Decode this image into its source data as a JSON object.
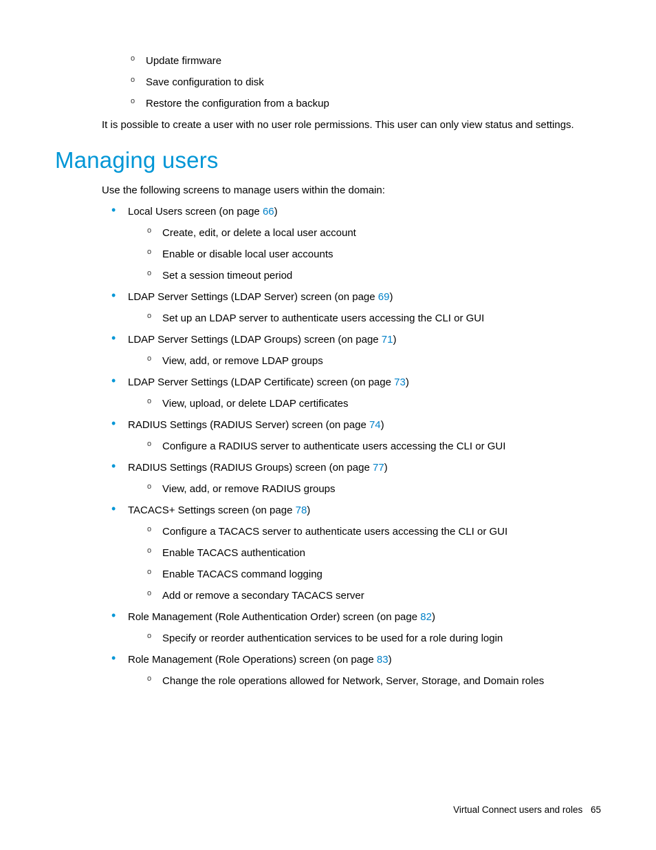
{
  "top_sub_items": [
    "Update firmware",
    "Save configuration to disk",
    "Restore the configuration from a backup"
  ],
  "body_para": "It is possible to create a user with no user role permissions. This user can only view status and settings.",
  "heading": "Managing users",
  "intro": "Use the following screens to manage users within the domain:",
  "items": [
    {
      "text_pre": "Local Users screen (on page ",
      "page": "66",
      "text_post": ")",
      "subs": [
        "Create, edit, or delete a local user account",
        "Enable or disable local user accounts",
        "Set a session timeout period"
      ]
    },
    {
      "text_pre": "LDAP Server Settings (LDAP Server) screen (on page ",
      "page": "69",
      "text_post": ")",
      "subs": [
        "Set up an LDAP server to authenticate users accessing the CLI or GUI"
      ]
    },
    {
      "text_pre": "LDAP Server Settings (LDAP Groups) screen (on page ",
      "page": "71",
      "text_post": ")",
      "subs": [
        "View, add, or remove LDAP groups"
      ]
    },
    {
      "text_pre": "LDAP Server Settings (LDAP Certificate) screen (on page ",
      "page": "73",
      "text_post": ")",
      "subs": [
        "View, upload, or delete LDAP certificates"
      ]
    },
    {
      "text_pre": "RADIUS Settings (RADIUS Server) screen (on page ",
      "page": "74",
      "text_post": ")",
      "subs": [
        "Configure a RADIUS server to authenticate users accessing the CLI or GUI"
      ]
    },
    {
      "text_pre": "RADIUS Settings (RADIUS Groups) screen (on page ",
      "page": "77",
      "text_post": ")",
      "subs": [
        "View, add, or remove RADIUS groups"
      ]
    },
    {
      "text_pre": "TACACS+ Settings screen (on page ",
      "page": "78",
      "text_post": ")",
      "subs": [
        "Configure a TACACS server to authenticate users accessing the CLI or GUI",
        "Enable TACACS authentication",
        "Enable TACACS command logging",
        "Add or remove a secondary TACACS server"
      ]
    },
    {
      "text_pre": "Role Management (Role Authentication Order) screen (on page ",
      "page": "82",
      "text_post": ")",
      "subs": [
        "Specify or reorder authentication services to be used for a role during login"
      ]
    },
    {
      "text_pre": "Role Management (Role Operations) screen (on page ",
      "page": "83",
      "text_post": ")",
      "subs": [
        "Change the role operations allowed for Network, Server, Storage, and Domain roles"
      ]
    }
  ],
  "footer_text": "Virtual Connect users and roles",
  "footer_page": "65"
}
